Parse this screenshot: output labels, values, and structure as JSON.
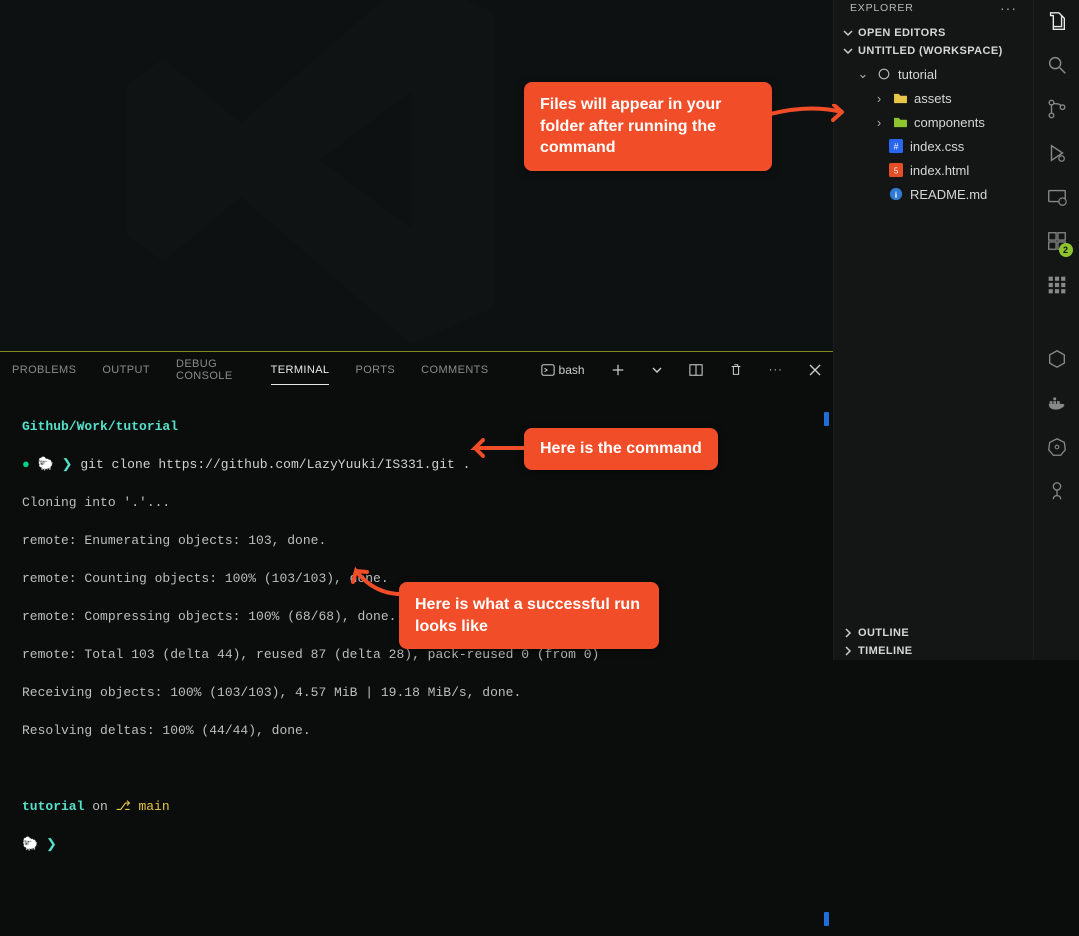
{
  "sidebar": {
    "title": "EXPLORER",
    "open_editors": "OPEN EDITORS",
    "workspace": "UNTITLED (WORKSPACE)",
    "outline": "OUTLINE",
    "timeline": "TIMELINE",
    "tree": {
      "root": "tutorial",
      "folders": [
        {
          "name": "assets"
        },
        {
          "name": "components"
        }
      ],
      "files": [
        {
          "name": "index.css",
          "type": "css"
        },
        {
          "name": "index.html",
          "type": "html"
        },
        {
          "name": "README.md",
          "type": "md"
        }
      ]
    }
  },
  "extension_badge": "2",
  "panel": {
    "tabs": [
      "PROBLEMS",
      "OUTPUT",
      "DEBUG CONSOLE",
      "TERMINAL",
      "PORTS",
      "COMMENTS"
    ],
    "active_tab": "TERMINAL",
    "shell": "bash"
  },
  "terminal": {
    "cwd_header": "Github/Work/tutorial",
    "command": "git clone https://github.com/LazyYuuki/IS331.git .",
    "out": [
      "Cloning into '.'...",
      "remote: Enumerating objects: 103, done.",
      "remote: Counting objects: 100% (103/103), done.",
      "remote: Compressing objects: 100% (68/68), done.",
      "remote: Total 103 (delta 44), reused 87 (delta 28), pack-reused 0 (from 0)",
      "Receiving objects: 100% (103/103), 4.57 MiB | 19.18 MiB/s, done.",
      "Resolving deltas: 100% (44/44), done."
    ],
    "prompt2_dir": "tutorial",
    "prompt2_on": " on ",
    "prompt2_branch": "main"
  },
  "callouts": {
    "files": "Files will appear in your folder after running the command",
    "command": "Here is the command",
    "success": "Here is what a successful run looks like"
  }
}
